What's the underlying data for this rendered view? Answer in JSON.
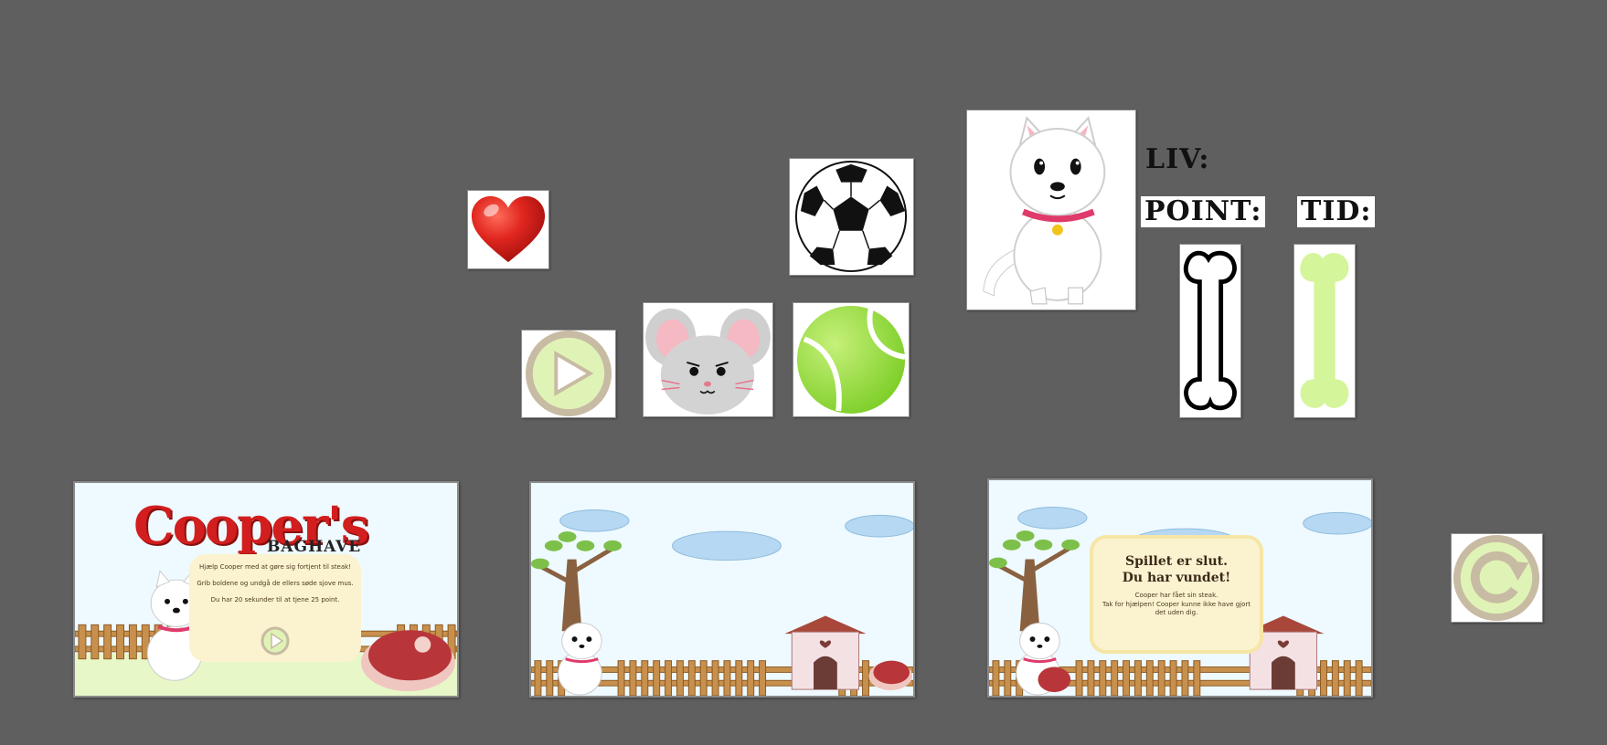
{
  "labels": {
    "liv": "LIV:",
    "point": "POINT:",
    "tid": "TID:"
  },
  "icons": {
    "heart": "heart-icon",
    "play": "play-button-icon",
    "mouse": "mouse-icon",
    "soccer_ball": "soccer-ball-icon",
    "tennis_ball": "tennis-ball-icon",
    "dog": "dog-icon",
    "bone_outline": "bone-outline-icon",
    "bone_filled": "bone-filled-icon",
    "replay": "replay-icon"
  },
  "intro_screen": {
    "logo": "Cooper's",
    "logo_sub": "BAGHAVE",
    "line1": "Hjælp Cooper med at gøre sig fortjent til steak!",
    "line2": "Grib boldene og undgå de ellers søde sjove mus.",
    "line3": "Du har 20 sekunder til at tjene 25 point."
  },
  "end_screen": {
    "title_line1": "Spillet er slut.",
    "title_line2": "Du har vundet!",
    "text_line1": "Cooper har fået sin steak.",
    "text_line2": "Tak for hjælpen! Cooper kunne ikke have gjort",
    "text_line3": "det uden dig."
  },
  "colors": {
    "background": "#5f5f5f",
    "heart_red": "#d9231f",
    "tennis_green": "#a9e34b",
    "bone_green": "#d4f59a",
    "sky": "#eefaff",
    "fence": "#b07a3c"
  }
}
